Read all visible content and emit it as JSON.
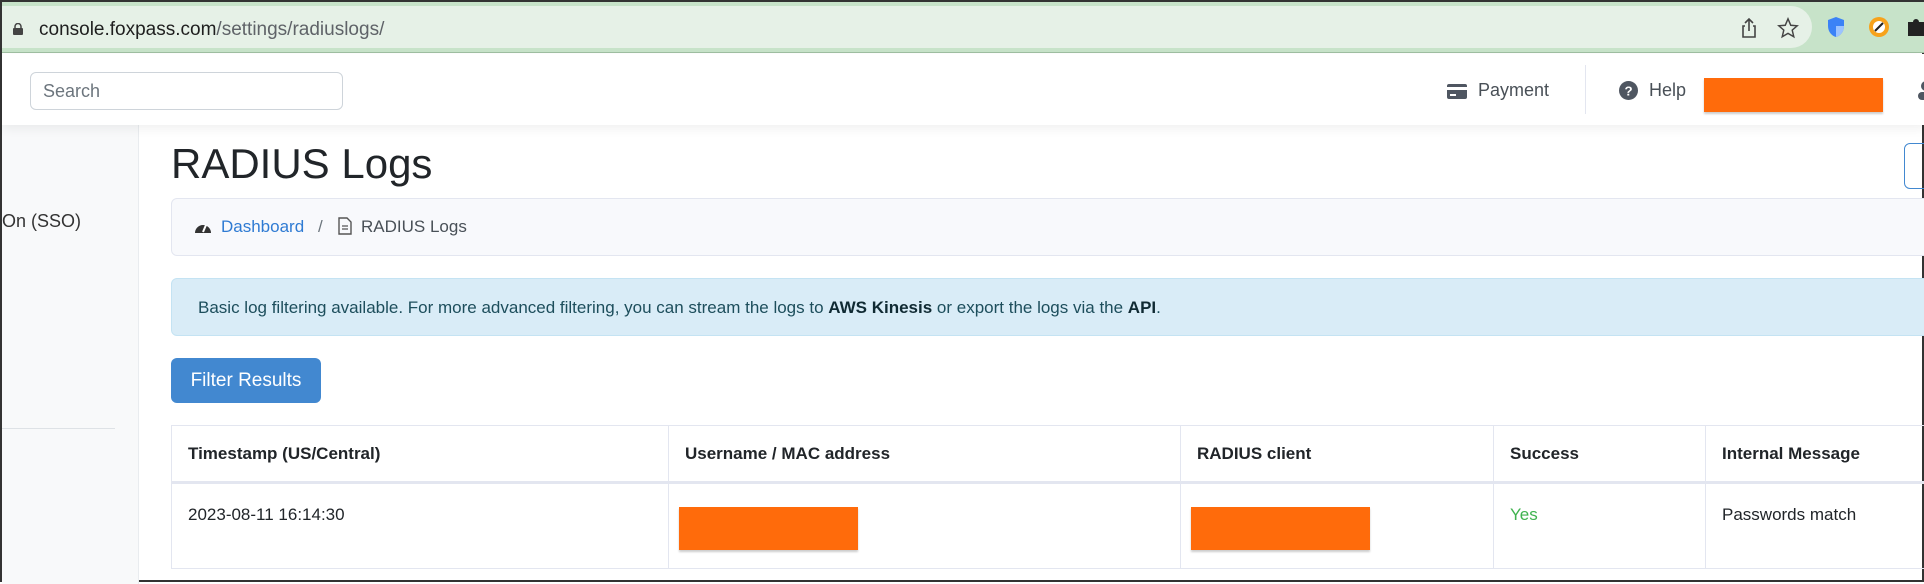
{
  "browser": {
    "url_host": "console.foxpass.com",
    "url_path": "/settings/radiuslogs/"
  },
  "header": {
    "search_placeholder": "Search",
    "payment": "Payment",
    "help": "Help",
    "redact_color": "#ff6b0b"
  },
  "sidebar": {
    "items": [
      {
        "label": "On (SSO)"
      }
    ]
  },
  "page": {
    "title": "RADIUS Logs"
  },
  "breadcrumb": {
    "home": "Dashboard",
    "separator": "/",
    "current": "RADIUS Logs"
  },
  "alert": {
    "text1": "Basic log filtering available. For more advanced filtering, you can stream the logs to ",
    "bold1": "AWS Kinesis",
    "text2": " or export the logs via the ",
    "bold2": "API",
    "text3": "."
  },
  "filter_button": "Filter Results",
  "table": {
    "columns": [
      "Timestamp (US/Central)",
      "Username / MAC address",
      "RADIUS client",
      "Success",
      "Internal Message"
    ],
    "rows": [
      {
        "timestamp": "2023-08-11 16:14:30",
        "success": "Yes",
        "message": "Passwords match"
      }
    ]
  },
  "colors": {
    "success": "#3fb34f",
    "primary": "#4288d0",
    "link": "#2f7bd3"
  }
}
